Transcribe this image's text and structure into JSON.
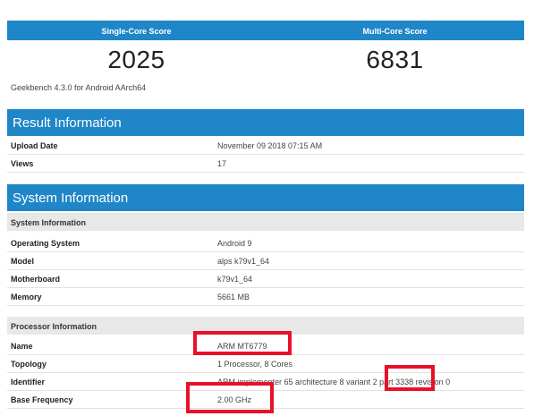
{
  "scores": {
    "single_label": "Single-Core Score",
    "multi_label": "Multi-Core Score",
    "single_value": "2025",
    "multi_value": "6831",
    "version": "Geekbench 4.3.0 for Android AArch64"
  },
  "result": {
    "title": "Result Information",
    "rows": [
      {
        "key": "Upload Date",
        "value": "November 09 2018 07:15 AM"
      },
      {
        "key": "Views",
        "value": "17"
      }
    ]
  },
  "system": {
    "title": "System Information",
    "sub_title": "System Information",
    "rows": [
      {
        "key": "Operating System",
        "value": "Android 9"
      },
      {
        "key": "Model",
        "value": "alps k79v1_64"
      },
      {
        "key": "Motherboard",
        "value": "k79v1_64"
      },
      {
        "key": "Memory",
        "value": "5661 MB"
      }
    ],
    "processor_title": "Processor Information",
    "processor_rows": [
      {
        "key": "Name",
        "value": "ARM MT6779"
      },
      {
        "key": "Topology",
        "value": "1 Processor, 8 Cores"
      },
      {
        "key": "Identifier",
        "value": "ARM implementer 65 architecture 8 variant 2 part 3338 revision 0"
      },
      {
        "key": "Base Frequency",
        "value": "2.00 GHz"
      }
    ]
  },
  "colors": {
    "accent": "#1f86c8",
    "highlight": "#e8102a"
  }
}
